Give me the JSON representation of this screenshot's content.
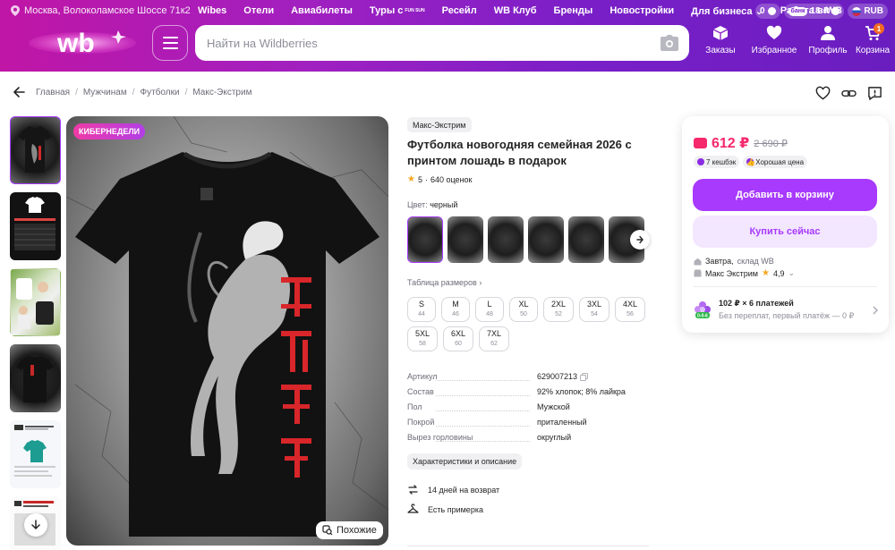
{
  "header": {
    "location": "Москва, Волоколамское Шоссе 71к2",
    "nav": [
      "Wibes",
      "Отели",
      "Авиабилеты",
      "Туры с",
      "Ресейл",
      "WB Клуб",
      "Бренды",
      "Новостройки",
      "Для бизнеса",
      "Работа в WB"
    ],
    "tours_brand": "FUN SUN",
    "wallet_balance": "0",
    "bank_label": "банк",
    "bank_balance": "18 ₽",
    "currency": "RUB",
    "logo_text": "wb",
    "search_placeholder": "Найти на Wildberries",
    "actions": [
      "Заказы",
      "Избранное",
      "Профиль",
      "Корзина"
    ],
    "cart_count": "1"
  },
  "breadcrumbs": [
    "Главная",
    "Мужчинам",
    "Футболки",
    "Макс-Экстрим"
  ],
  "gallery": {
    "promo_badge": "КИБЕРНЕДЕЛИ",
    "similar_label": "Похожие",
    "thumbnail_count": 6
  },
  "product": {
    "brand": "Макс-Экстрим",
    "title": "Футболка новогодняя семейная 2026 с принтом лошадь в подарок",
    "rating": "5",
    "reviews": "640 оценок",
    "color_label": "Цвет:",
    "color_value": "черный",
    "size_table_label": "Таблица размеров",
    "sizes": [
      {
        "name": "S",
        "ru": "44"
      },
      {
        "name": "M",
        "ru": "46"
      },
      {
        "name": "L",
        "ru": "48"
      },
      {
        "name": "XL",
        "ru": "50"
      },
      {
        "name": "2XL",
        "ru": "52"
      },
      {
        "name": "3XL",
        "ru": "54"
      },
      {
        "name": "4XL",
        "ru": "56"
      },
      {
        "name": "5XL",
        "ru": "58"
      },
      {
        "name": "6XL",
        "ru": "60"
      },
      {
        "name": "7XL",
        "ru": "62"
      }
    ],
    "specs": [
      {
        "key": "Артикул",
        "value": "629007213"
      },
      {
        "key": "Состав",
        "value": "92% хлопок; 8% лайкра"
      },
      {
        "key": "Пол",
        "value": "Мужской"
      },
      {
        "key": "Покрой",
        "value": "приталенный"
      },
      {
        "key": "Вырез горловины",
        "value": "округлый"
      }
    ],
    "details_button": "Характеристики и описание",
    "return_info": "14 дней на возврат",
    "fitting_info": "Есть примерка"
  },
  "buy_card": {
    "price": "612 ₽",
    "old_price": "2 690 ₽",
    "cashback": "7 кешбэк",
    "good_price": "Хорошая цена",
    "add_to_cart": "Добавить в корзину",
    "buy_now": "Купить сейчас",
    "delivery_day": "Завтра,",
    "delivery_place": "склад WB",
    "seller": "Макс Экстрим",
    "seller_rating": "4,9",
    "installment_title": "102 ₽ × 6 платежей",
    "installment_sub": "Без переплат, первый платёж — 0 ₽",
    "installment_badge": "0-0-6"
  },
  "colors": {
    "accent": "#a73afd",
    "price": "#f5286b",
    "header_start": "#c016a6",
    "header_end": "#6a1ec0"
  }
}
